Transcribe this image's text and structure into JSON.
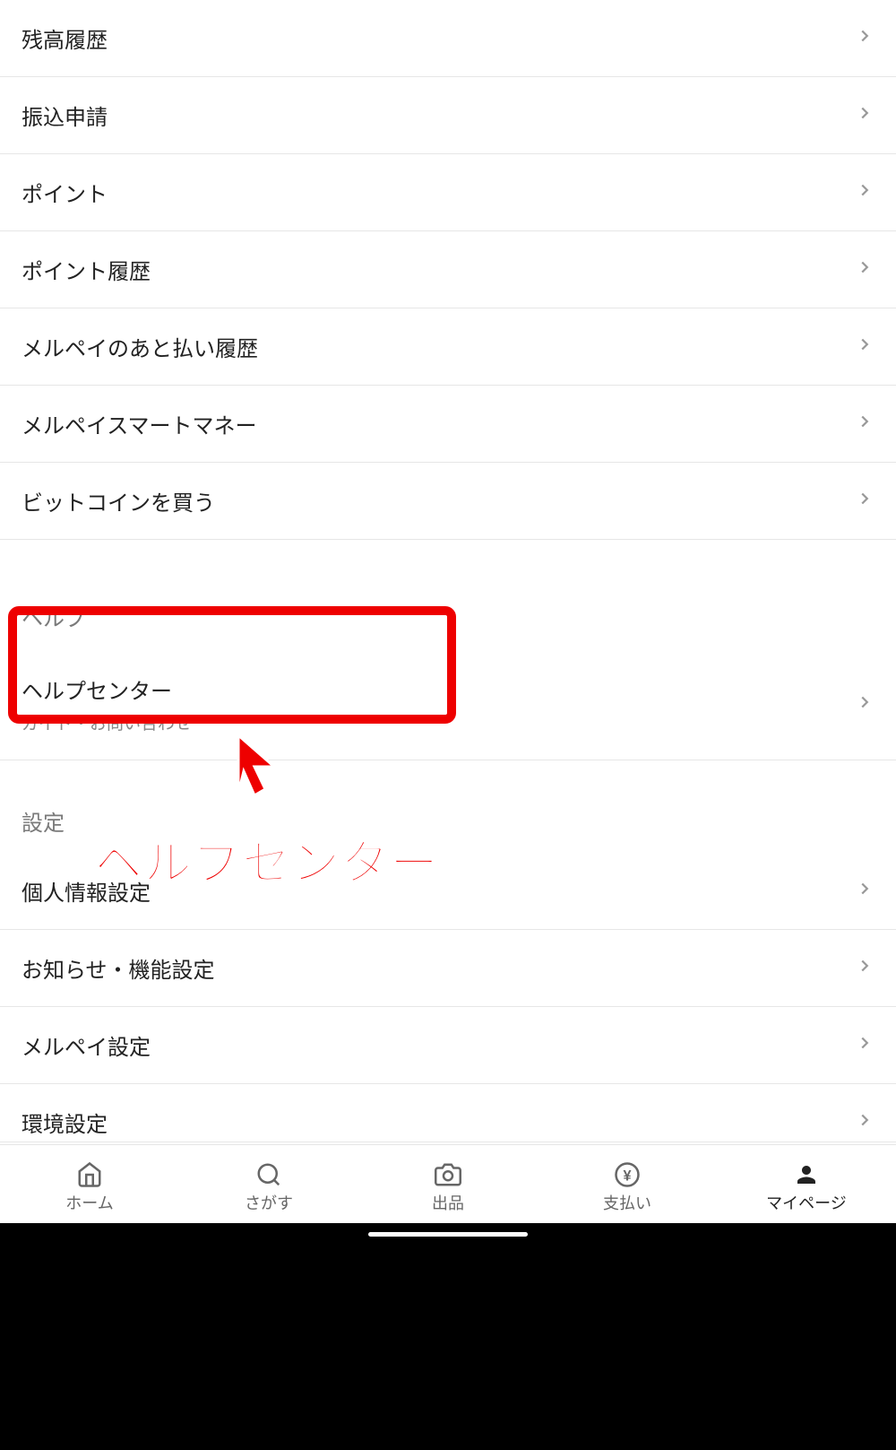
{
  "menu_items": [
    {
      "label": "残高履歴"
    },
    {
      "label": "振込申請"
    },
    {
      "label": "ポイント"
    },
    {
      "label": "ポイント履歴"
    },
    {
      "label": "メルペイのあと払い履歴"
    },
    {
      "label": "メルペイスマートマネー"
    },
    {
      "label": "ビットコインを買う"
    }
  ],
  "help_section": {
    "title": "ヘルプ",
    "items": [
      {
        "label": "ヘルプセンター",
        "sublabel": "ガイド・お問い合わせ"
      }
    ]
  },
  "settings_section": {
    "title": "設定",
    "items": [
      {
        "label": "個人情報設定"
      },
      {
        "label": "お知らせ・機能設定"
      },
      {
        "label": "メルペイ設定"
      },
      {
        "label": "環境設定"
      }
    ]
  },
  "nav": {
    "items": [
      {
        "label": "ホーム",
        "icon": "home"
      },
      {
        "label": "さがす",
        "icon": "search"
      },
      {
        "label": "出品",
        "icon": "camera"
      },
      {
        "label": "支払い",
        "icon": "yen"
      },
      {
        "label": "マイページ",
        "icon": "person",
        "active": true
      }
    ]
  },
  "annotation": {
    "text": "ヘルプセンター",
    "highlight_color": "#ee0000"
  }
}
